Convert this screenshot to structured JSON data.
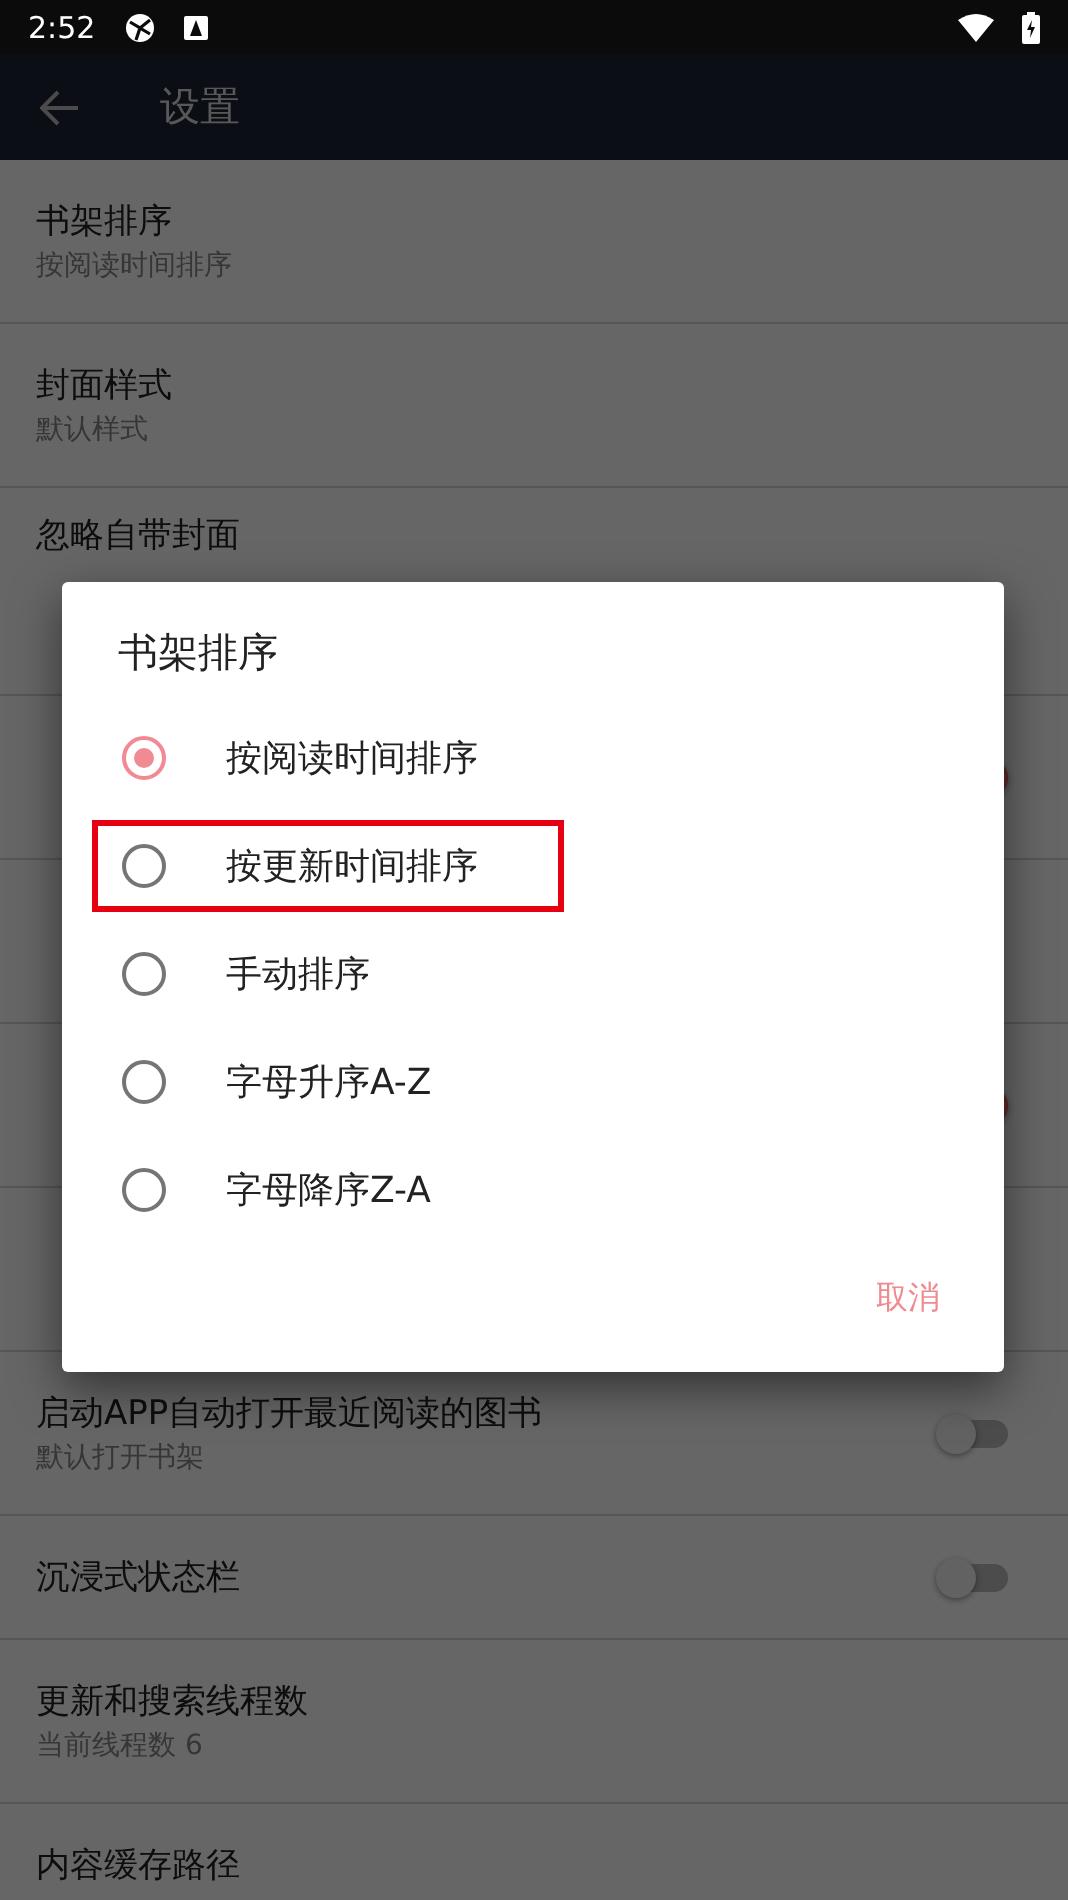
{
  "status_bar": {
    "time": "2:52"
  },
  "app_bar": {
    "title": "设置"
  },
  "settings": [
    {
      "title": "书架排序",
      "subtitles": [
        "按阅读时间排序"
      ]
    },
    {
      "title": "封面样式",
      "subtitles": [
        "默认样式"
      ]
    },
    {
      "title": "忽略自带封面",
      "kind": "multiline"
    },
    {
      "kind": "switch",
      "on": true
    },
    {
      "kind": "plain"
    },
    {
      "kind": "switch",
      "on": true
    },
    {
      "kind": "plain"
    },
    {
      "title": "启动APP自动打开最近阅读的图书",
      "subtitles": [
        "默认打开书架"
      ],
      "kind": "switch",
      "on": false
    },
    {
      "title": "沉浸式状态栏",
      "kind": "switch",
      "on": false
    },
    {
      "title": "更新和搜索线程数",
      "subtitles": [
        "当前线程数 6"
      ]
    },
    {
      "title": "内容缓存路径"
    }
  ],
  "dialog": {
    "title": "书架排序",
    "options": [
      {
        "label": "按阅读时间排序",
        "selected": true,
        "highlighted": false
      },
      {
        "label": "按更新时间排序",
        "selected": false,
        "highlighted": true
      },
      {
        "label": "手动排序",
        "selected": false,
        "highlighted": false
      },
      {
        "label": "字母升序A-Z",
        "selected": false,
        "highlighted": false
      },
      {
        "label": "字母降序Z-A",
        "selected": false,
        "highlighted": false
      }
    ],
    "cancel": "取消"
  }
}
